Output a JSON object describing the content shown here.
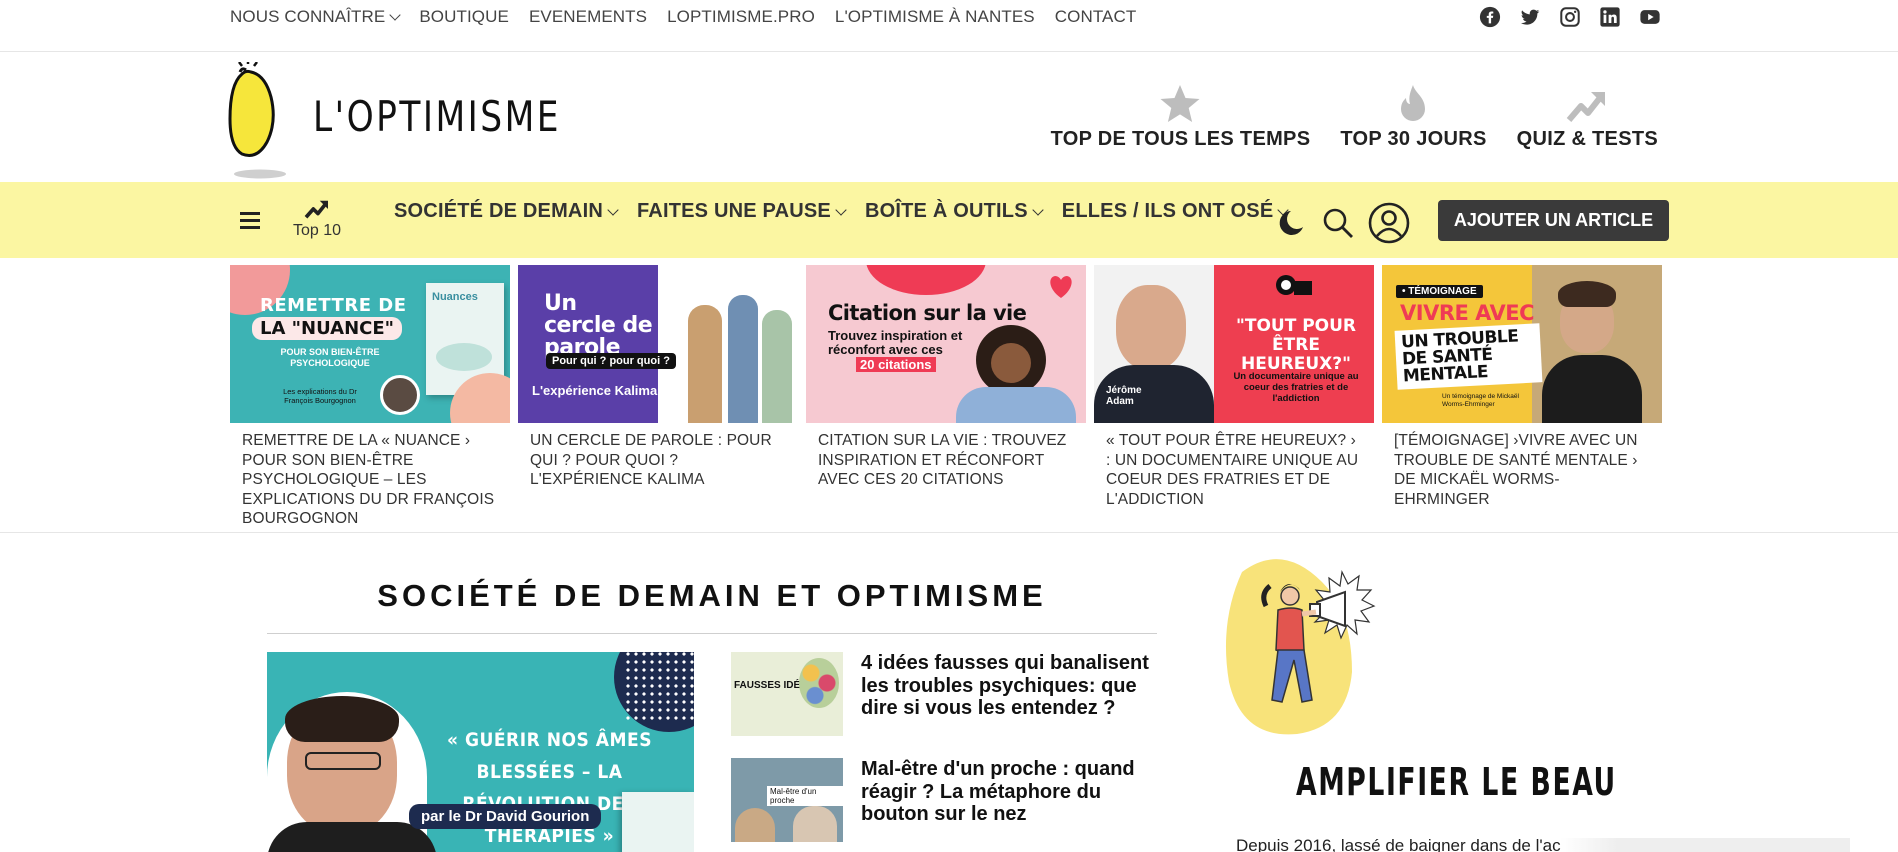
{
  "topnav": {
    "items": [
      {
        "label": "NOUS CONNAÎTRE",
        "dropdown": true
      },
      {
        "label": "BOUTIQUE"
      },
      {
        "label": "EVENEMENTS"
      },
      {
        "label": "LOPTIMISME.PRO"
      },
      {
        "label": "L'OPTIMISME À NANTES"
      },
      {
        "label": "CONTACT"
      }
    ],
    "social": [
      "facebook-icon",
      "twitter-icon",
      "instagram-icon",
      "linkedin-icon",
      "youtube-icon"
    ]
  },
  "header": {
    "logo_text": "L'OPTIMISME",
    "tops": [
      "TOP DE TOUS LES TEMPS",
      "TOP 30 JOURS",
      "QUIZ & TESTS"
    ]
  },
  "mainnav": {
    "top10_label": "Top 10",
    "menu": [
      "SOCIÉTÉ DE DEMAIN",
      "FAITES UNE PAUSE",
      "BOÎTE À OUTILS",
      "ELLES / ILS ONT OSÉ"
    ],
    "add_button": "AJOUTER UN ARTICLE"
  },
  "featured": [
    {
      "caption": "REMETTRE DE LA « NUANCE › POUR SON BIEN-ÊTRE PSYCHOLOGIQUE – LES EXPLICATIONS DU DR FRANÇOIS BOURGOGNON",
      "img_title": "REMETTRE DE",
      "img_title2": "LA \"NUANCE\"",
      "img_sub": "POUR SON BIEN-ÊTRE PSYCHOLOGIQUE",
      "img_note": "Les explications du Dr François Bourgognon",
      "img_book": "Nuances"
    },
    {
      "caption": "UN CERCLE DE PAROLE : POUR QUI ? POUR QUOI ? L'EXPÉRIENCE KALIMA",
      "img_title": "Un cercle de parole",
      "img_sub": "Pour qui ? pour quoi ?",
      "img_note": "L'expérience Kalima"
    },
    {
      "caption": "CITATION SUR LA VIE : TROUVEZ INSPIRATION ET RÉCONFORT AVEC CES 20 CITATIONS",
      "img_title": "Citation sur la vie",
      "img_sub": "Trouvez inspiration et réconfort avec ces",
      "img_note": "20 citations"
    },
    {
      "caption": "« TOUT POUR ÊTRE HEUREUX? › : UN DOCUMENTAIRE UNIQUE AU COEUR DES FRATRIES ET DE L'ADDICTION",
      "img_title": "\"TOUT POUR ÊTRE HEUREUX?\"",
      "img_sub": "Un documentaire unique au coeur des fratries et de l'addiction",
      "img_note": "Jérôme Adam"
    },
    {
      "caption": "[TÉMOIGNAGE] ›VIVRE AVEC UN TROUBLE DE SANTÉ MENTALE › DE MICKAËL WORMS-EHRMINGER",
      "img_tag": "• TÉMOIGNAGE",
      "img_title": "VIVRE AVEC",
      "img_sub": "UN TROUBLE DE SANTÉ MENTALE",
      "img_note": "Un témoignage de Mickaël Worms-Ehrminger"
    }
  ],
  "section": {
    "title": "SOCIÉTÉ DE DEMAIN ET OPTIMISME",
    "feature_img_title": "« GUÉRIR NOS ÂMES BLESSÉES – LA RÉVOLUTION DES THÉRAPIES »",
    "feature_img_author": "par le Dr David Gourion",
    "list": [
      {
        "title": "4 idées fausses qui banalisent les troubles psychiques: que dire si vous les entendez ?",
        "thumb_text": "FAUSSES IDÉES"
      },
      {
        "title": "Mal-être d'un proche : quand réagir ? La métaphore du bouton sur le nez",
        "thumb_text": "Mal-être d'un proche"
      }
    ]
  },
  "sidebar": {
    "heading": "AMPLIFIER LE BEAU",
    "intro": "Depuis 2016, lassé de baigner dans de l'ac"
  },
  "colors": {
    "nav_yellow": "#fbf6a2",
    "button_dark": "#3a3a3a",
    "teal": "#39b4b5"
  }
}
